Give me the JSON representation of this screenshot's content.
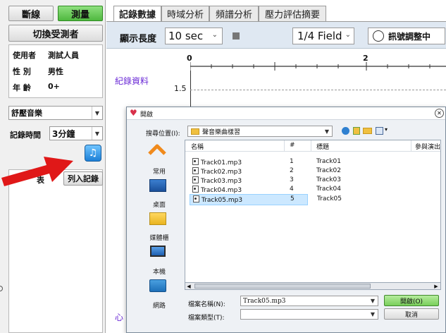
{
  "left": {
    "disconnect_btn": "斷線",
    "measure_btn": "測量",
    "switch_user_btn": "切換受測者",
    "user_label": "使用者",
    "user_value": "測試人員",
    "gender_label": "性 別",
    "gender_value": "男性",
    "age_label": "年 齡",
    "age_value": "0+",
    "music_select": "舒壓音樂",
    "record_time_label": "記錄時間",
    "record_time_value": "3分鐘",
    "list_partial_label": "表",
    "add_record_btn": "列入記錄"
  },
  "tabs": [
    "記錄數據",
    "時域分析",
    "頻譜分析",
    "壓力評估摘要"
  ],
  "toolbar": {
    "display_length_label": "顯示長度",
    "display_length_value": "10 sec",
    "field_value": "1/4 Field",
    "signal_label": "訊號調整中"
  },
  "chart": {
    "axis_top_0": "0",
    "axis_top_2": "2",
    "record_label": "紀錄資料",
    "y_tick": "1.5",
    "bottom_label": "心"
  },
  "dialog": {
    "title": "開啟",
    "lookin_label": "搜尋位置(I):",
    "lookin_value": "聲音樂曲樣習",
    "sidebar": [
      "常用",
      "桌面",
      "媒體櫃",
      "本機",
      "網路"
    ],
    "columns": [
      "名稱",
      "#",
      "標題",
      "參與演出"
    ],
    "files": [
      {
        "name": "Track01.mp3",
        "num": "1",
        "title": "Track01"
      },
      {
        "name": "Track02.mp3",
        "num": "2",
        "title": "Track02"
      },
      {
        "name": "Track03.mp3",
        "num": "3",
        "title": "Track03"
      },
      {
        "name": "Track04.mp3",
        "num": "4",
        "title": "Track04"
      },
      {
        "name": "Track05.mp3",
        "num": "5",
        "title": "Track05"
      }
    ],
    "selected_index": 4,
    "filename_label": "檔案名稱(N):",
    "filename_value": "Track05.mp3",
    "filetype_label": "檔案類型(T):",
    "filetype_value": "",
    "open_btn": "開啟(O)",
    "cancel_btn": "取消"
  },
  "colors": {
    "accent_green": "#58c84a",
    "selection_blue": "#cce8ff",
    "arrow_red": "#e01818",
    "chart_label_purple": "#6b2bd6"
  }
}
